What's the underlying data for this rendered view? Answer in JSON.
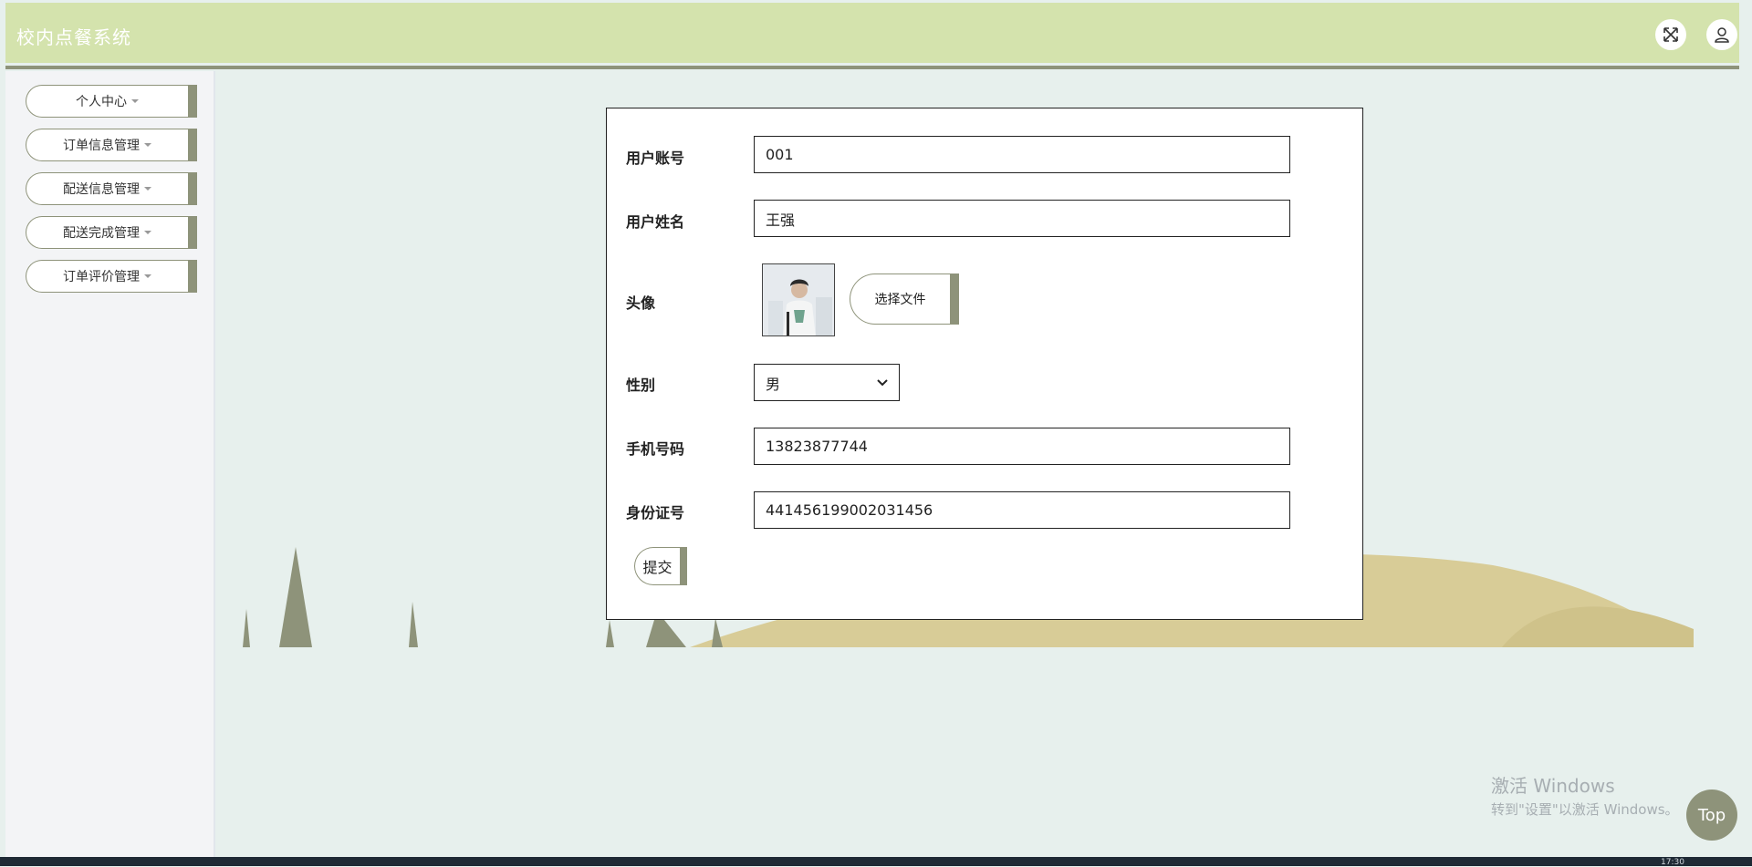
{
  "app": {
    "title": "校内点餐系统"
  },
  "header": {
    "fullscreen_icon": "expand-arrows-icon",
    "user_icon": "user-icon"
  },
  "sidebar": {
    "items": [
      {
        "label": "个人中心"
      },
      {
        "label": "订单信息管理"
      },
      {
        "label": "配送信息管理"
      },
      {
        "label": "配送完成管理"
      },
      {
        "label": "订单评价管理"
      }
    ]
  },
  "form": {
    "account": {
      "label": "用户账号",
      "value": "001"
    },
    "name": {
      "label": "用户姓名",
      "value": "王强"
    },
    "avatar": {
      "label": "头像",
      "file_button": "选择文件"
    },
    "gender": {
      "label": "性别",
      "value": "男"
    },
    "phone": {
      "label": "手机号码",
      "value": "13823877744"
    },
    "id_number": {
      "label": "身份证号",
      "value": "441456199002031456"
    },
    "submit_label": "提交"
  },
  "watermark": {
    "line1": "激活 Windows",
    "line2": "转到\"设置\"以激活 Windows。"
  },
  "top_button": {
    "label": "Top"
  },
  "taskbar": {
    "clock": "17:30"
  },
  "colors": {
    "header": "#d4e3ad",
    "accent": "#8e937a",
    "background": "#e7f0ed",
    "hill": "#d8cc97"
  }
}
